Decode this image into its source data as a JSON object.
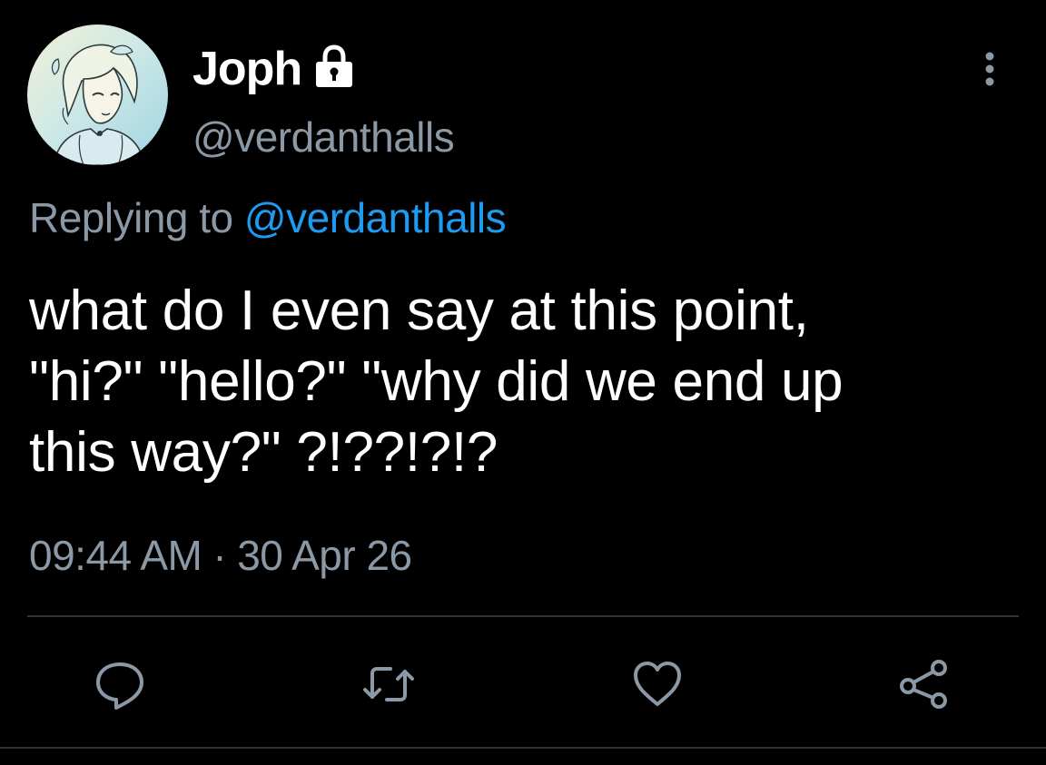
{
  "author": {
    "display_name": "Joph",
    "handle": "@verdanthalls",
    "protected": true,
    "avatar_icon": "avatar-illustration",
    "lock_icon": "lock-icon"
  },
  "reply": {
    "prefix": "Replying to",
    "mention": "@verdanthalls"
  },
  "tweet": {
    "text": "what do I even say at this point,\n\"hi?\" \"hello?\" \"why did we end up\nthis way?\" ?!??!?!?"
  },
  "meta": {
    "time": "09:44 AM",
    "separator": "·",
    "date": "30 Apr 26"
  },
  "actions": [
    {
      "name": "reply",
      "icon": "comment-icon"
    },
    {
      "name": "retweet",
      "icon": "retweet-icon"
    },
    {
      "name": "like",
      "icon": "heart-icon"
    },
    {
      "name": "share",
      "icon": "share-icon"
    }
  ],
  "colors": {
    "background": "#000000",
    "text": "#ffffff",
    "secondary": "#8b98a5",
    "accent": "#1d9bf0",
    "divider": "#2f3336"
  }
}
